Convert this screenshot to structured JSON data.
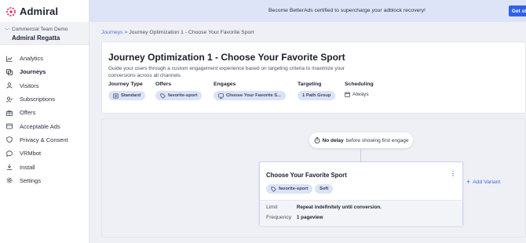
{
  "app": {
    "brand": "Admiral"
  },
  "org": {
    "team": "Commercial Team Demo",
    "property": "Admiral Regatta"
  },
  "nav": [
    {
      "label": "Analytics",
      "icon": "analytics-icon",
      "active": false
    },
    {
      "label": "Journeys",
      "icon": "journeys-icon",
      "active": true
    },
    {
      "label": "Visitors",
      "icon": "visitors-icon",
      "active": false
    },
    {
      "label": "Subscriptions",
      "icon": "subscriptions-icon",
      "active": false
    },
    {
      "label": "Offers",
      "icon": "offers-icon",
      "active": false
    },
    {
      "label": "Acceptable Ads",
      "icon": "acceptable-ads-icon",
      "active": false
    },
    {
      "label": "Privacy & Consent",
      "icon": "privacy-icon",
      "active": false
    },
    {
      "label": "VRMbot",
      "icon": "chat-icon",
      "active": false
    },
    {
      "label": "Install",
      "icon": "install-icon",
      "active": false
    },
    {
      "label": "Settings",
      "icon": "gear-icon",
      "active": false
    }
  ],
  "banner": {
    "text": "Become BetterAds certified to supercharge your adblock recovery!",
    "button": "Get started"
  },
  "breadcrumb": {
    "root": "Journeys",
    "separator": ">",
    "current": "Journey Optimization 1 - Choose Your Favorite Sport"
  },
  "journey": {
    "title": "Journey Optimization 1 - Choose Your Favorite Sport",
    "description": "Guide your users through a custom engagement experience based on targeting criteria to maximize your conversions across all channels.",
    "columns": {
      "type_label": "Journey Type",
      "type_value": "Standard",
      "offers_label": "Offers",
      "offers_value": "favorite-sport",
      "engages_label": "Engages",
      "engages_value": "Choose Your Favorite S...",
      "targeting_label": "Targeting",
      "targeting_value": "1 Path Group",
      "scheduling_label": "Scheduling",
      "scheduling_value": "Always"
    }
  },
  "canvas": {
    "delay": {
      "bold": "No delay",
      "rest": "before showing first engage"
    },
    "variant": {
      "title": "Choose Your Favorite Sport",
      "menu": "⋮",
      "offer_chip": "favorite-sport",
      "type_chip": "Soft",
      "limit_label": "Limit",
      "limit_value": "Repeat indefinitely until conversion.",
      "frequency_label": "Frequency",
      "frequency_value": "1 pageview"
    },
    "add_variant": "Add Variant"
  },
  "colors": {
    "accent": "#2f61e8",
    "chip": "#dbe3f7",
    "brand_red": "#e0245e"
  }
}
